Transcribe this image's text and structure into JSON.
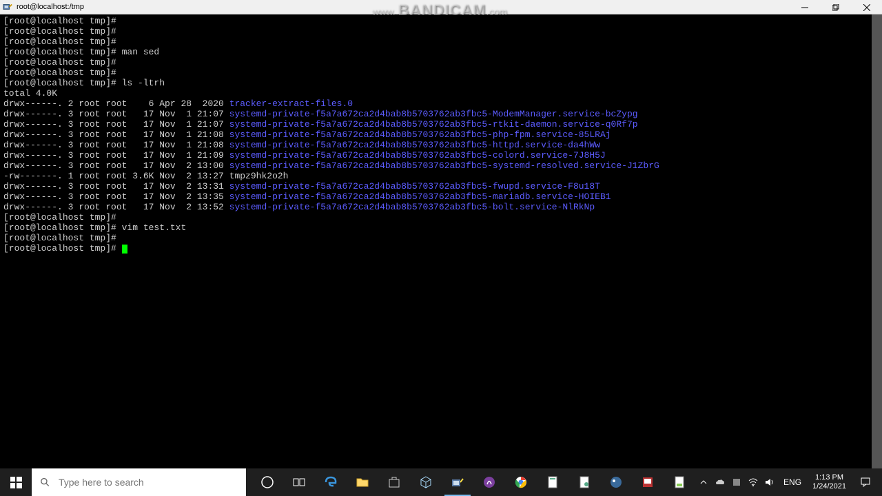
{
  "titlebar": {
    "title": "root@localhost:/tmp"
  },
  "watermark": {
    "prefix": "www.",
    "text": "BANDICAM",
    "suffix": ".com"
  },
  "terminal": {
    "prompt": "[root@localhost tmp]# ",
    "lines": [
      {
        "prompt": "[root@localhost tmp]# ",
        "cmd": ""
      },
      {
        "prompt": "[root@localhost tmp]# ",
        "cmd": ""
      },
      {
        "prompt": "[root@localhost tmp]# ",
        "cmd": ""
      },
      {
        "prompt": "[root@localhost tmp]# ",
        "cmd": "man sed"
      },
      {
        "prompt": "[root@localhost tmp]# ",
        "cmd": ""
      },
      {
        "prompt": "[root@localhost tmp]# ",
        "cmd": ""
      },
      {
        "prompt": "[root@localhost tmp]# ",
        "cmd": "ls -ltrh"
      }
    ],
    "total": "total 4.0K",
    "listing": [
      {
        "perm": "drwx------. 2 root root    6 Apr 28  2020 ",
        "name": "tracker-extract-files.0",
        "dir": true
      },
      {
        "perm": "drwx------. 3 root root   17 Nov  1 21:07 ",
        "name": "systemd-private-f5a7a672ca2d4bab8b5703762ab3fbc5-ModemManager.service-bcZypg",
        "dir": true
      },
      {
        "perm": "drwx------. 3 root root   17 Nov  1 21:07 ",
        "name": "systemd-private-f5a7a672ca2d4bab8b5703762ab3fbc5-rtkit-daemon.service-q0Rf7p",
        "dir": true
      },
      {
        "perm": "drwx------. 3 root root   17 Nov  1 21:08 ",
        "name": "systemd-private-f5a7a672ca2d4bab8b5703762ab3fbc5-php-fpm.service-85LRAj",
        "dir": true
      },
      {
        "perm": "drwx------. 3 root root   17 Nov  1 21:08 ",
        "name": "systemd-private-f5a7a672ca2d4bab8b5703762ab3fbc5-httpd.service-da4hWw",
        "dir": true
      },
      {
        "perm": "drwx------. 3 root root   17 Nov  1 21:09 ",
        "name": "systemd-private-f5a7a672ca2d4bab8b5703762ab3fbc5-colord.service-7J8H5J",
        "dir": true
      },
      {
        "perm": "drwx------. 3 root root   17 Nov  2 13:00 ",
        "name": "systemd-private-f5a7a672ca2d4bab8b5703762ab3fbc5-systemd-resolved.service-J1ZbrG",
        "dir": true
      },
      {
        "perm": "-rw-------. 1 root root 3.6K Nov  2 13:27 ",
        "name": "tmpz9hk2o2h",
        "dir": false
      },
      {
        "perm": "drwx------. 3 root root   17 Nov  2 13:31 ",
        "name": "systemd-private-f5a7a672ca2d4bab8b5703762ab3fbc5-fwupd.service-F8u18T",
        "dir": true
      },
      {
        "perm": "drwx------. 3 root root   17 Nov  2 13:35 ",
        "name": "systemd-private-f5a7a672ca2d4bab8b5703762ab3fbc5-mariadb.service-HOIEB1",
        "dir": true
      },
      {
        "perm": "drwx------. 3 root root   17 Nov  2 13:52 ",
        "name": "systemd-private-f5a7a672ca2d4bab8b5703762ab3fbc5-bolt.service-NlRkNp",
        "dir": true
      }
    ],
    "after": [
      {
        "prompt": "[root@localhost tmp]# ",
        "cmd": ""
      },
      {
        "prompt": "[root@localhost tmp]# ",
        "cmd": "vim test.txt"
      },
      {
        "prompt": "[root@localhost tmp]# ",
        "cmd": ""
      },
      {
        "prompt": "[root@localhost tmp]# ",
        "cmd": "",
        "cursor": true
      }
    ]
  },
  "taskbar": {
    "search_placeholder": "Type here to search",
    "lang": "ENG",
    "time": "1:13 PM",
    "date": "1/24/2021"
  }
}
